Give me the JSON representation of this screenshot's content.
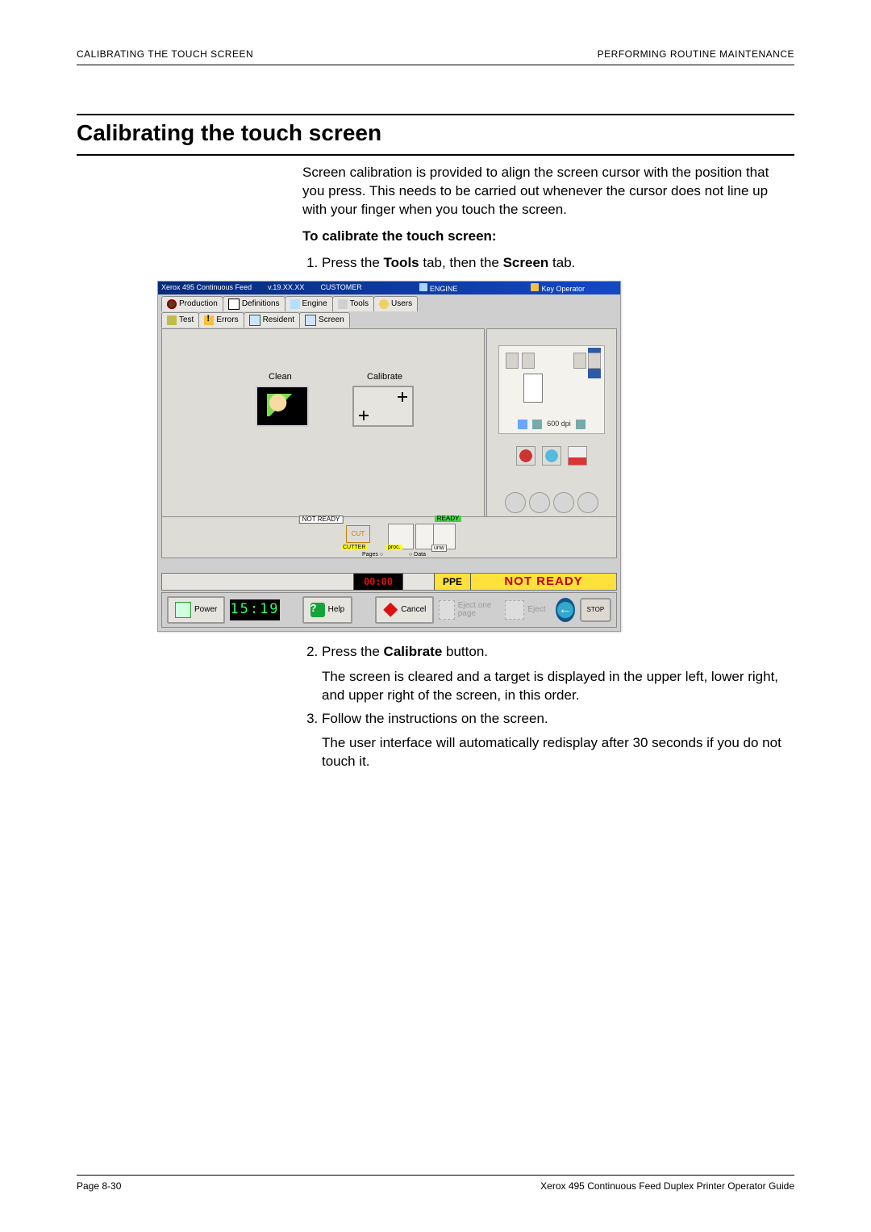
{
  "running_header": {
    "left": "CALIBRATING THE TOUCH SCREEN",
    "right": "PERFORMING ROUTINE MAINTENANCE"
  },
  "section_title": "Calibrating the touch screen",
  "intro": "Screen calibration is provided to align the screen cursor with the position that you press. This needs to be carried out whenever the cursor does not line up with your finger when you touch the screen.",
  "procedure_heading": "To calibrate the touch screen:",
  "steps": {
    "s1_pre": "Press the ",
    "s1_b1": "Tools",
    "s1_mid": " tab, then the ",
    "s1_b2": "Screen",
    "s1_post": " tab.",
    "s2_pre": "Press the ",
    "s2_b1": "Calibrate",
    "s2_post": " button.",
    "s2_follow": "The screen is cleared and a target is displayed in the upper left, lower right, and upper right of the screen, in this order.",
    "s3": "Follow the instructions on the screen.",
    "s3_follow": "The user interface will automatically redisplay after 30 seconds if you do not touch it."
  },
  "screenshot": {
    "titlebar": {
      "product": "Xerox   495 Continuous Feed",
      "version": "v.19.XX.XX",
      "customer": "CUSTOMER",
      "engine": "ENGINE",
      "key_operator": "Key Operator"
    },
    "tabs_main": {
      "production": "Production",
      "definitions": "Definitions",
      "engine": "Engine",
      "tools": "Tools",
      "users": "Users"
    },
    "tabs_sub": {
      "test": "Test",
      "errors": "Errors",
      "resident": "Resident",
      "screen": "Screen"
    },
    "panel": {
      "clean": "Clean",
      "calibrate": "Calibrate"
    },
    "sidebar": {
      "dpi": "600 dpi"
    },
    "footer_strip": {
      "not_ready_label": "NOT READY",
      "ready_label": "READY",
      "cut": "CUT",
      "cutter": "CUTTER",
      "proc": "proc.",
      "unw": "unw",
      "pages": "Pages  ○",
      "data": "○  Data"
    },
    "statusbar": {
      "clock_zero": "00:00",
      "ppe": "PPE",
      "not_ready": "NOT READY"
    },
    "buttonbar": {
      "power": "Power",
      "clock": "15:19",
      "help": "Help",
      "cancel": "Cancel",
      "eject_one": "Eject one page",
      "eject": "Eject",
      "stop": "STOP"
    }
  },
  "running_footer": {
    "left": "Page 8-30",
    "right": "Xerox 495 Continuous Feed Duplex Printer Operator Guide"
  }
}
